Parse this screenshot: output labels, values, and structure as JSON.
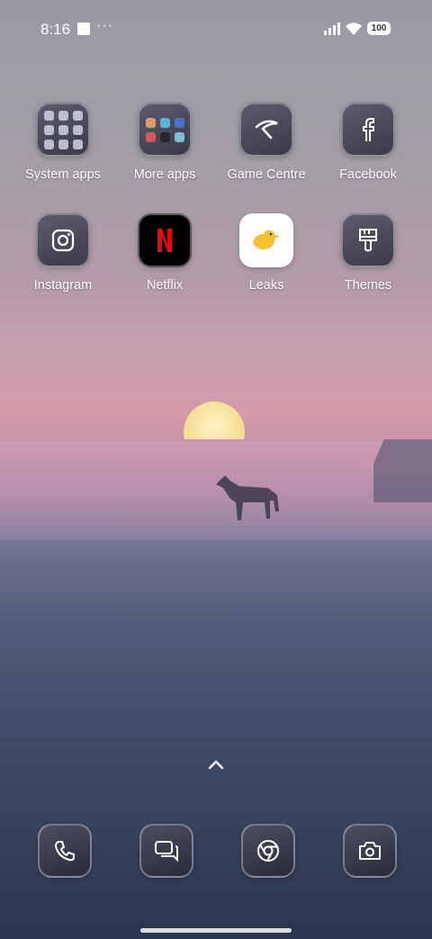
{
  "status_bar": {
    "time": "8:16",
    "more": "···",
    "battery": "100"
  },
  "home_apps": [
    {
      "label": "System apps"
    },
    {
      "label": "More apps"
    },
    {
      "label": "Game Centre"
    },
    {
      "label": "Facebook"
    },
    {
      "label": "Instagram"
    },
    {
      "label": "Netflix"
    },
    {
      "label": "Leaks"
    },
    {
      "label": "Themes"
    }
  ],
  "dock": [
    "phone-icon",
    "messages-icon",
    "chrome-icon",
    "camera-icon"
  ],
  "colors": {
    "accent": "#ffffff",
    "netflix": "#e50914",
    "leaks_bg": "#ffffff",
    "leaks_bird": "#f2c230"
  }
}
